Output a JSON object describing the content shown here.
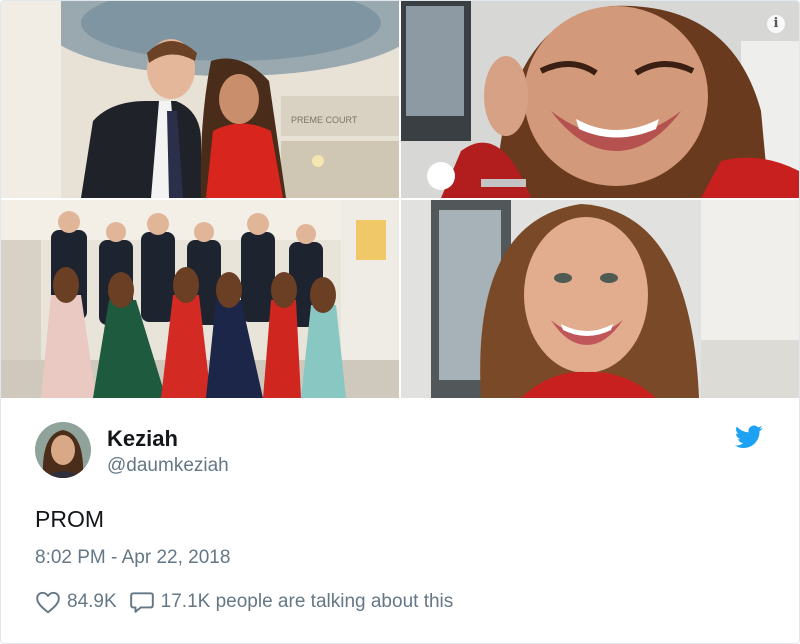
{
  "tweet": {
    "name": "Keziah",
    "handle": "@daumkeziah",
    "text": "PROM",
    "timestamp": "8:02 PM - Apr 22, 2018",
    "likes": "84.9K",
    "conversation": "17.1K people are talking about this",
    "info_label": "i"
  },
  "media": {
    "photo_1": {
      "sign_text": "PREME COURT"
    }
  },
  "icons": {
    "info": "info-icon",
    "bird": "twitter-bird-icon",
    "like": "heart-icon",
    "reply": "speech-bubble-icon"
  },
  "colors": {
    "twitter_blue": "#1da1f2",
    "text_primary": "#14171a",
    "text_secondary": "#657786",
    "border": "#e1e8ed"
  }
}
